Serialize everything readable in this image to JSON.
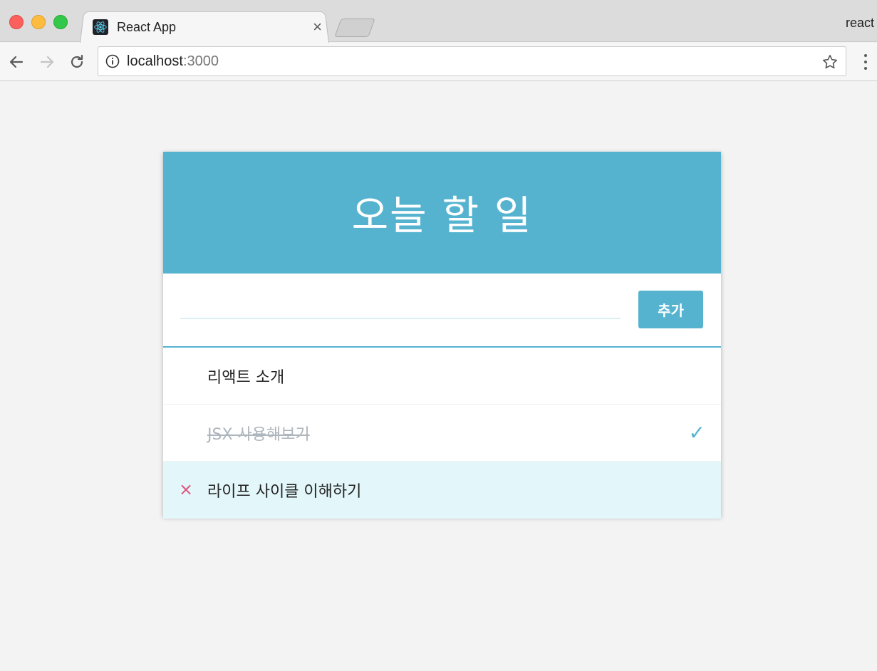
{
  "browser": {
    "tab": {
      "title": "React App",
      "close_glyph": "×",
      "favicon": "react-logo-icon"
    },
    "profile_label": "react",
    "url": {
      "host": "localhost",
      "port": ":3000"
    },
    "icons": {
      "back": "arrow-left-icon",
      "forward": "arrow-right-icon",
      "reload": "reload-icon",
      "info": "info-icon",
      "star": "star-icon",
      "menu": "kebab-menu-icon"
    }
  },
  "app": {
    "title": "오늘 할 일",
    "input": {
      "value": "",
      "placeholder": ""
    },
    "add_button_label": "추가",
    "colors": {
      "accent": "#56b3cf",
      "hover_row": "#e3f7fb",
      "remove": "#e0527a",
      "checked_text": "#adb5bd"
    },
    "todos": [
      {
        "text": "리액트 소개",
        "checked": false,
        "hovered": false,
        "remove_glyph": "",
        "check_glyph": ""
      },
      {
        "text": "JSX 사용해보기",
        "checked": true,
        "hovered": false,
        "remove_glyph": "",
        "check_glyph": "✓"
      },
      {
        "text": "라이프 사이클 이해하기",
        "checked": false,
        "hovered": true,
        "remove_glyph": "×",
        "check_glyph": ""
      }
    ]
  }
}
